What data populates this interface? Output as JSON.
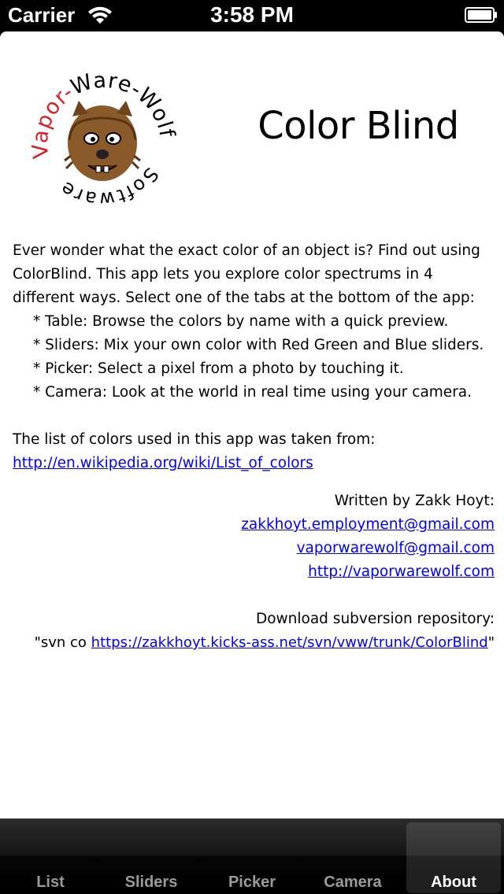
{
  "status_bar": {
    "carrier": "Carrier",
    "time": "3:58 PM"
  },
  "header": {
    "app_title": "Color Blind",
    "logo_text_top": "Vapor-Ware-Wolf",
    "logo_text_bottom": "Software"
  },
  "body": {
    "intro": "Ever wonder what the exact color of an object is? Find out using ColorBlind. This app lets you explore color spectrums in 4 different ways. Select one of the tabs at the bottom of the app:",
    "bullets": [
      "* Table: Browse the colors by name with a quick preview.",
      "* Sliders: Mix your own color with Red Green and Blue sliders.",
      "* Picker: Select a pixel from a photo by touching it.",
      "* Camera: Look at the world in real time using your camera."
    ],
    "source_text": "The list of colors used in this app was taken from:",
    "source_link": "http://en.wikipedia.org/wiki/List_of_colors",
    "written_by": "Written by Zakk Hoyt:",
    "email_1": "zakkhoyt.employment@gmail.com",
    "email_2": "vaporwarewolf@gmail.com",
    "website": "http://vaporwarewolf.com",
    "download_label": "Download subversion repository:",
    "svn_prefix": "\"svn co ",
    "svn_link": "https://zakkhoyt.kicks-ass.net/svn/vww/trunk/ColorBlind",
    "svn_suffix": "\""
  },
  "tab_bar": {
    "tabs": [
      {
        "label": "List",
        "active": false
      },
      {
        "label": "Sliders",
        "active": false
      },
      {
        "label": "Picker",
        "active": false
      },
      {
        "label": "Camera",
        "active": false
      },
      {
        "label": "About",
        "active": true
      }
    ]
  },
  "colors": {
    "link": "#0000ee",
    "logo_red": "#d4232a",
    "tab_active_text": "#ffffff",
    "tab_inactive_text": "#9a9a9a"
  },
  "icons": [
    "wifi-icon",
    "battery-icon",
    "wolf-logo"
  ]
}
